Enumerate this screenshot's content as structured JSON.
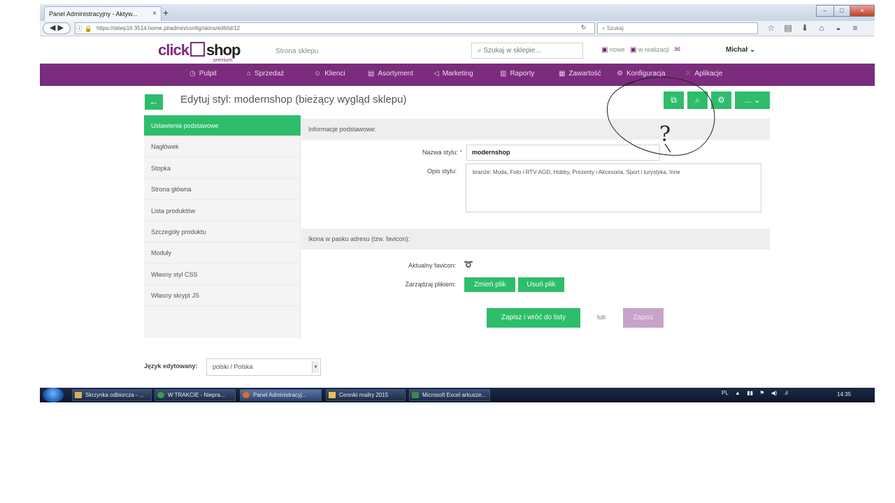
{
  "browser": {
    "tab_title": "Panel Administracyjny - Aktyw...",
    "tab_close": "×",
    "new_tab": "+",
    "url": "https://sklep16 3514.home.pl/admin/config/skins/edit/id/12",
    "search_placeholder": "Szukaj",
    "window_buttons": [
      "–",
      "□",
      "×"
    ]
  },
  "site": {
    "logo_click": "click",
    "logo_shop": "shop",
    "logo_premium": "premium",
    "store_link": "Strona sklepu",
    "search_placeholder": "Szukaj w sklepie...",
    "link_new": "nowe",
    "link_in_progress": "w realizacji",
    "user_name": "Michał"
  },
  "nav": {
    "items": [
      {
        "label": "Pulpit",
        "icon": "dashboard-icon"
      },
      {
        "label": "Sprzedaż",
        "icon": "cart-icon"
      },
      {
        "label": "Klienci",
        "icon": "users-icon"
      },
      {
        "label": "Asortyment",
        "icon": "box-icon"
      },
      {
        "label": "Marketing",
        "icon": "megaphone-icon"
      },
      {
        "label": "Raporty",
        "icon": "bar-chart-icon"
      },
      {
        "label": "Zawartość",
        "icon": "document-icon"
      },
      {
        "label": "Konfiguracja",
        "icon": "gear-icon"
      },
      {
        "label": "Aplikacje",
        "icon": "grid-icon"
      }
    ]
  },
  "page": {
    "title": "Edytuj styl: modernshop (bieżący wygląd sklepu)",
    "more_label": "..."
  },
  "sidebar": {
    "items": [
      {
        "label": "Ustawienia podstawowe",
        "active": true
      },
      {
        "label": "Nagłówek"
      },
      {
        "label": "Stopka"
      },
      {
        "label": "Strona główna"
      },
      {
        "label": "Lista produktów"
      },
      {
        "label": "Szczegóły produktu"
      },
      {
        "label": "Moduły"
      },
      {
        "label": "Własny styl CSS"
      },
      {
        "label": "Własny skrypt JS"
      }
    ]
  },
  "form": {
    "section_basic": "Informacje podstawowe:",
    "name_label": "Nazwa stylu:",
    "name_required": "*",
    "name_value": "modernshop",
    "desc_label": "Opis stylu:",
    "desc_value": "branże: Moda, Foto i RTV-AGD, Hobby, Prezenty i Akcesoria, Sport i turystyka, Inne",
    "section_favicon": "Ikona w pasku adresu (tzw. favicon):",
    "current_favicon_label": "Aktualny favicon:",
    "manage_file_label": "Zarządzaj plikiem:",
    "change_file": "Zmień plik",
    "delete_file": "Usuń plik",
    "save_and_return": "Zapisz i wróć do listy",
    "or": "lub",
    "save": "Zapisz"
  },
  "language": {
    "label": "Język edytowany:",
    "value": "polski / Polska"
  },
  "taskbar": {
    "items": [
      "Skrzynka odbiorcza - ...",
      "W TRAKCIE - Niepra...",
      "Panel Administracyj...",
      "Cenniki mailry 2015",
      "Microsoft Excel arkusze..."
    ],
    "language_indicator": "PL",
    "clock": "14:35"
  },
  "annotation": {
    "question_mark": "?"
  }
}
